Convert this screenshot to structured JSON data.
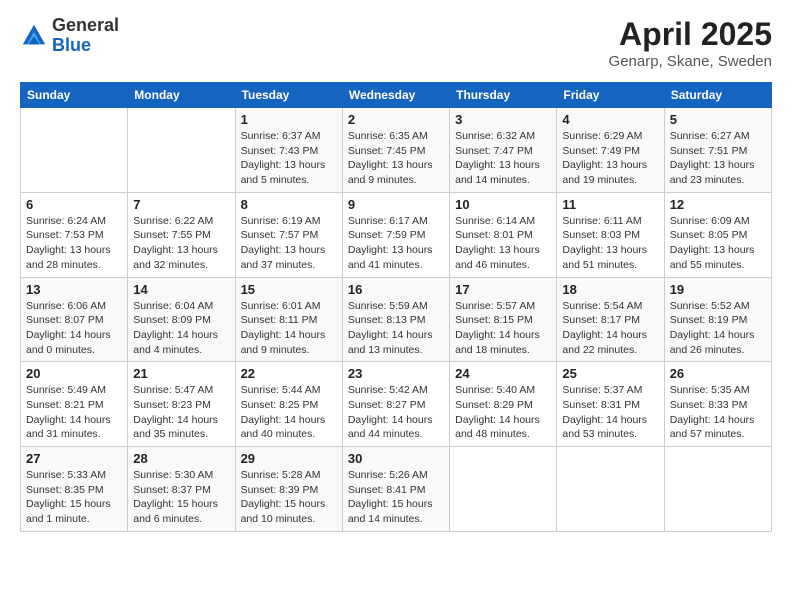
{
  "logo": {
    "general": "General",
    "blue": "Blue"
  },
  "title": {
    "month": "April 2025",
    "location": "Genarp, Skane, Sweden"
  },
  "days_of_week": [
    "Sunday",
    "Monday",
    "Tuesday",
    "Wednesday",
    "Thursday",
    "Friday",
    "Saturday"
  ],
  "weeks": [
    [
      {
        "day": "",
        "info": ""
      },
      {
        "day": "",
        "info": ""
      },
      {
        "day": "1",
        "info": "Sunrise: 6:37 AM\nSunset: 7:43 PM\nDaylight: 13 hours and 5 minutes."
      },
      {
        "day": "2",
        "info": "Sunrise: 6:35 AM\nSunset: 7:45 PM\nDaylight: 13 hours and 9 minutes."
      },
      {
        "day": "3",
        "info": "Sunrise: 6:32 AM\nSunset: 7:47 PM\nDaylight: 13 hours and 14 minutes."
      },
      {
        "day": "4",
        "info": "Sunrise: 6:29 AM\nSunset: 7:49 PM\nDaylight: 13 hours and 19 minutes."
      },
      {
        "day": "5",
        "info": "Sunrise: 6:27 AM\nSunset: 7:51 PM\nDaylight: 13 hours and 23 minutes."
      }
    ],
    [
      {
        "day": "6",
        "info": "Sunrise: 6:24 AM\nSunset: 7:53 PM\nDaylight: 13 hours and 28 minutes."
      },
      {
        "day": "7",
        "info": "Sunrise: 6:22 AM\nSunset: 7:55 PM\nDaylight: 13 hours and 32 minutes."
      },
      {
        "day": "8",
        "info": "Sunrise: 6:19 AM\nSunset: 7:57 PM\nDaylight: 13 hours and 37 minutes."
      },
      {
        "day": "9",
        "info": "Sunrise: 6:17 AM\nSunset: 7:59 PM\nDaylight: 13 hours and 41 minutes."
      },
      {
        "day": "10",
        "info": "Sunrise: 6:14 AM\nSunset: 8:01 PM\nDaylight: 13 hours and 46 minutes."
      },
      {
        "day": "11",
        "info": "Sunrise: 6:11 AM\nSunset: 8:03 PM\nDaylight: 13 hours and 51 minutes."
      },
      {
        "day": "12",
        "info": "Sunrise: 6:09 AM\nSunset: 8:05 PM\nDaylight: 13 hours and 55 minutes."
      }
    ],
    [
      {
        "day": "13",
        "info": "Sunrise: 6:06 AM\nSunset: 8:07 PM\nDaylight: 14 hours and 0 minutes."
      },
      {
        "day": "14",
        "info": "Sunrise: 6:04 AM\nSunset: 8:09 PM\nDaylight: 14 hours and 4 minutes."
      },
      {
        "day": "15",
        "info": "Sunrise: 6:01 AM\nSunset: 8:11 PM\nDaylight: 14 hours and 9 minutes."
      },
      {
        "day": "16",
        "info": "Sunrise: 5:59 AM\nSunset: 8:13 PM\nDaylight: 14 hours and 13 minutes."
      },
      {
        "day": "17",
        "info": "Sunrise: 5:57 AM\nSunset: 8:15 PM\nDaylight: 14 hours and 18 minutes."
      },
      {
        "day": "18",
        "info": "Sunrise: 5:54 AM\nSunset: 8:17 PM\nDaylight: 14 hours and 22 minutes."
      },
      {
        "day": "19",
        "info": "Sunrise: 5:52 AM\nSunset: 8:19 PM\nDaylight: 14 hours and 26 minutes."
      }
    ],
    [
      {
        "day": "20",
        "info": "Sunrise: 5:49 AM\nSunset: 8:21 PM\nDaylight: 14 hours and 31 minutes."
      },
      {
        "day": "21",
        "info": "Sunrise: 5:47 AM\nSunset: 8:23 PM\nDaylight: 14 hours and 35 minutes."
      },
      {
        "day": "22",
        "info": "Sunrise: 5:44 AM\nSunset: 8:25 PM\nDaylight: 14 hours and 40 minutes."
      },
      {
        "day": "23",
        "info": "Sunrise: 5:42 AM\nSunset: 8:27 PM\nDaylight: 14 hours and 44 minutes."
      },
      {
        "day": "24",
        "info": "Sunrise: 5:40 AM\nSunset: 8:29 PM\nDaylight: 14 hours and 48 minutes."
      },
      {
        "day": "25",
        "info": "Sunrise: 5:37 AM\nSunset: 8:31 PM\nDaylight: 14 hours and 53 minutes."
      },
      {
        "day": "26",
        "info": "Sunrise: 5:35 AM\nSunset: 8:33 PM\nDaylight: 14 hours and 57 minutes."
      }
    ],
    [
      {
        "day": "27",
        "info": "Sunrise: 5:33 AM\nSunset: 8:35 PM\nDaylight: 15 hours and 1 minute."
      },
      {
        "day": "28",
        "info": "Sunrise: 5:30 AM\nSunset: 8:37 PM\nDaylight: 15 hours and 6 minutes."
      },
      {
        "day": "29",
        "info": "Sunrise: 5:28 AM\nSunset: 8:39 PM\nDaylight: 15 hours and 10 minutes."
      },
      {
        "day": "30",
        "info": "Sunrise: 5:26 AM\nSunset: 8:41 PM\nDaylight: 15 hours and 14 minutes."
      },
      {
        "day": "",
        "info": ""
      },
      {
        "day": "",
        "info": ""
      },
      {
        "day": "",
        "info": ""
      }
    ]
  ]
}
